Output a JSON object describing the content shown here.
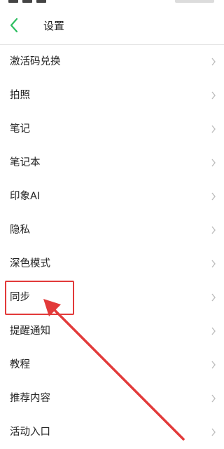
{
  "header": {
    "back_icon": "chevron-left-icon",
    "title": "设置",
    "accent_color": "#2dbe60"
  },
  "menu": {
    "chevron_icon": "chevron-right-icon",
    "items": [
      {
        "label": "激活码兑换"
      },
      {
        "label": "拍照"
      },
      {
        "label": "笔记"
      },
      {
        "label": "笔记本"
      },
      {
        "label": "印象AI"
      },
      {
        "label": "隐私"
      },
      {
        "label": "深色模式"
      },
      {
        "label": "同步"
      },
      {
        "label": "提醒通知"
      },
      {
        "label": "教程"
      },
      {
        "label": "推荐内容"
      },
      {
        "label": "活动入口"
      }
    ]
  },
  "annotation": {
    "highlighted_item": "同步",
    "color": "#e23a3a"
  }
}
